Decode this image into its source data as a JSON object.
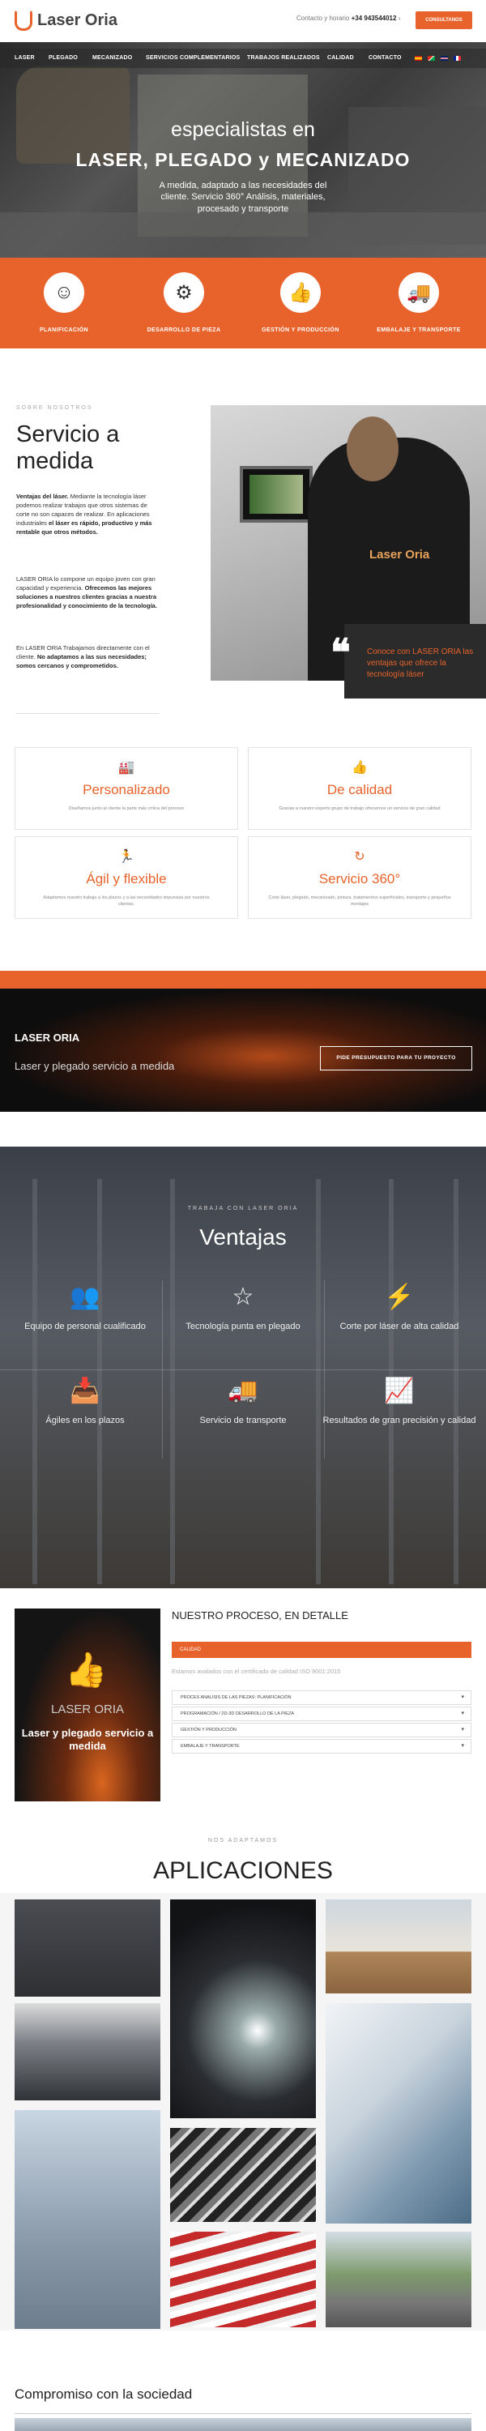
{
  "header": {
    "logo_text": "Laser Oria",
    "contact_label": "Contacto y horario",
    "phone": "+34 943544012",
    "consult_button": "CONSULTANOS"
  },
  "nav": {
    "items": [
      "LASER",
      "PLEGADO",
      "MECANIZADO",
      "SERVICIOS COMPLEMENTARIOS",
      "TRABAJOS REALIZADOS",
      "CALIDAD",
      "CONTACTO"
    ],
    "languages": [
      "es",
      "eu",
      "en",
      "fr"
    ]
  },
  "hero": {
    "title_line1": "especialistas en",
    "title_line2": "LASER, PLEGADO y MECANIZADO",
    "subtitle": "A medida, adaptado a las necesidades del cliente. Servicio 360° Análisis, materiales, procesado y transporte"
  },
  "features": [
    {
      "icon": "head-gear-icon",
      "label": "PLANIFICACIÓN"
    },
    {
      "icon": "gear-icon",
      "label": "DESARROLLO DE PIEZA"
    },
    {
      "icon": "thumbs-up-icon",
      "label": "GESTIÓN Y PRODUCCIÓN"
    },
    {
      "icon": "truck-icon",
      "label": "EMBALAJE Y TRANSPORTE"
    }
  ],
  "about": {
    "kicker": "SOBRE NOSOTROS",
    "title": "Servicio a medida",
    "p1_bold": "Ventajas del láser.",
    "p1": " Mediante la tecnología láser podemos realizar trabajos que otros sistemas de corte no son capaces de realizar. En aplicaciones industriales ",
    "p1_bold2": "el láser es rápido, productivo y más rentable que otros métodos.",
    "p2": "LASER ORIA lo compone un equipo joven con gran capacidad y experiencia. ",
    "p2_bold": "Ofrecemos las mejores soluciones a nuestros clientes gracias a nuestra profesionalidad y conocimiento de la tecnología.",
    "p3": "En LASER ORIA Trabajamos directamente con el cliente. ",
    "p3_bold": "No adaptamos a las sus necesidades; somos cercanos y comprometidos.",
    "photo_logo": "Laser Oria",
    "quote": "Conoce con LASER ORIA las ventajas que ofrece la tecnología láser"
  },
  "cards": [
    {
      "icon": "factory-icon",
      "title": "Personalizado",
      "desc": "Diseñamos junto al cliente la parte más crítica del proceso"
    },
    {
      "icon": "thumbs-up-icon",
      "title": "De calidad",
      "desc": "Gracias a nuestro experto grupo de trabajo ofrecemos un servicio de gran calidad"
    },
    {
      "icon": "running-icon",
      "title": "Ágil y flexible",
      "desc": "Adaptamos nuestro trabajo a los plazos y a las necesidades impuestas por nuestros clientes."
    },
    {
      "icon": "refresh-icon",
      "title": "Servicio 360°",
      "desc": "Corte láser, plegado, mecanizado, pintura, tratamientos superficiales, transporte y pequeños montajes"
    }
  ],
  "cta": {
    "title": "LASER ORIA",
    "subtitle": "Laser y plegado servicio a medida",
    "button": "PIDE PRESUPUESTO PARA TU PROYECTO"
  },
  "advantages": {
    "kicker": "TRABAJA CON LASER ORIA",
    "title": "Ventajas",
    "items": [
      {
        "icon": "team-icon",
        "label": "Equipo de personal cualificado"
      },
      {
        "icon": "star-icon",
        "label": "Tecnología punta en plegado"
      },
      {
        "icon": "laser-icon",
        "label": "Corte por láser de alta calidad"
      },
      {
        "icon": "inbox-icon",
        "label": "Ágiles en los plazos"
      },
      {
        "icon": "truck-icon",
        "label": "Servicio de transporte"
      },
      {
        "icon": "chart-icon",
        "label": "Resultados de gran precisión y calidad"
      }
    ]
  },
  "process": {
    "image_title": "LASER ORIA",
    "image_subtitle": "Laser y plegado servicio a medida",
    "title": "NUESTRO PROCESO, EN DETALLE",
    "active": "CALIDAD",
    "note": "Estamos avalados con el certificado de calidad ISO 9001:2015",
    "items": [
      "PROCES ANALISIS DE LAS PIEZAS: PLANIFICACIÓN",
      "PROGRAMACIÓN / 2D-3D DESARROLLO DE LA PIEZA",
      "GESTIÓN Y PRODUCCIÓN",
      "EMBALAJE Y TRANSPORTE"
    ]
  },
  "applications": {
    "kicker": "NOS ADAPTAMOS",
    "title": "APLICACIONES"
  },
  "footer": {
    "title": "Compromiso con la sociedad"
  },
  "colors": {
    "accent": "#e8632b",
    "dark": "#2b2b2b"
  }
}
